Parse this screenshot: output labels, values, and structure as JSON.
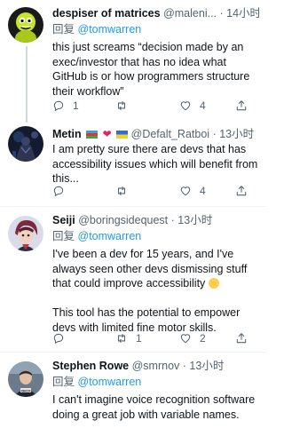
{
  "tweets": [
    {
      "name": "despiser of matrices",
      "handle": "@maleni...",
      "dot": "·",
      "time": "14小时",
      "reply_prefix": "回复",
      "reply_to": "@tomwarren",
      "text_lines": [
        "this just screams “decision made by an exec/investor that has no idea what GitHub is or how programmers structure their workflow”"
      ],
      "likes": "4"
    },
    {
      "name": "Metin",
      "handle": "@Defalt_Ratboi",
      "dot": "·",
      "time": "13小时",
      "text_lines": [
        "I am pretty sure there are devs that has accessibility issues which will benefit from this..."
      ],
      "likes": "4"
    },
    {
      "name": "Seiji",
      "handle": "@boringsidequest",
      "dot": "·",
      "time": "13小时",
      "reply_prefix": "回复",
      "reply_to": "@tomwarren",
      "text_p1": "I've been a dev for 15 years, and I've always seen other devs dismissing stuff that could improve accessibility",
      "text_p2": "This tool has the potential to empower devs with limited fine motor skills.",
      "likes": "2"
    },
    {
      "name": "Stephen Rowe",
      "handle": "@smrnov",
      "dot": "·",
      "time": "13小时",
      "reply_prefix": "回复",
      "reply_to": "@tomwarren",
      "text_lines": [
        "I can't imagine voice recognition software doing a great job with variable names."
      ]
    }
  ],
  "icons": {
    "reply": "reply-icon",
    "retweet": "retweet-icon",
    "like": "heart-icon",
    "share": "share-icon"
  },
  "colors": {
    "link": "#1d9bf0",
    "secondary": "#536471",
    "thread_line": "#cfd9de",
    "heart": "#e0245e"
  }
}
